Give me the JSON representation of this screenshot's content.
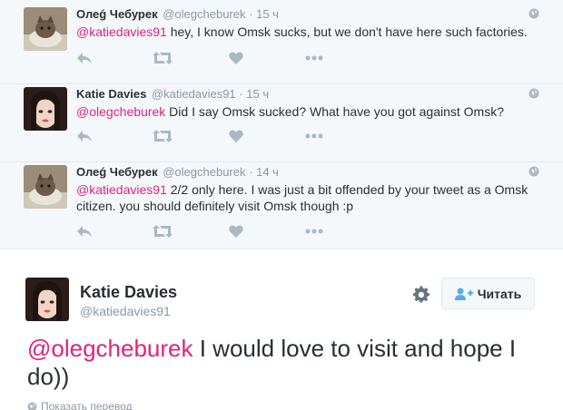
{
  "replies": [
    {
      "fullname": "Олеǵ Чебурек",
      "username": "@olegcheburek",
      "separator": "·",
      "time": "15 ч",
      "mention": "@katiedavies91",
      "text": " hey, I know Omsk sucks, but we don't have here such factories.",
      "avatar": "cat-avatar"
    },
    {
      "fullname": "Katie Davies",
      "username": "@katiedavies91",
      "separator": "·",
      "time": "15 ч",
      "mention": "@olegcheburek",
      "text": " Did I say Omsk sucked? What have you got against Omsk?",
      "avatar": "woman-avatar"
    },
    {
      "fullname": "Олеǵ Чебурек",
      "username": "@olegcheburek",
      "separator": "·",
      "time": "14 ч",
      "mention": "@katiedavies91",
      "text": " 2/2 only here. I was just a bit offended by your tweet as a Omsk citizen. you should definitely visit Omsk though :p",
      "avatar": "cat-avatar"
    }
  ],
  "main_tweet": {
    "fullname": "Katie Davies",
    "username": "@katiedavies91",
    "follow_label": "Читать",
    "mention": "@olegcheburek",
    "text": " I would love to visit and hope I do))",
    "translate_label": "Показать перевод"
  },
  "colors": {
    "mention": "#e0247a",
    "muted": "#8899a6",
    "reply_bg": "#f5f8fa",
    "border": "#e1e8ed",
    "action_icon": "#aab8c2"
  },
  "icons": [
    "reply-icon",
    "retweet-icon",
    "like-icon",
    "more-icon",
    "globe-icon",
    "gear-icon",
    "follow-icon"
  ]
}
